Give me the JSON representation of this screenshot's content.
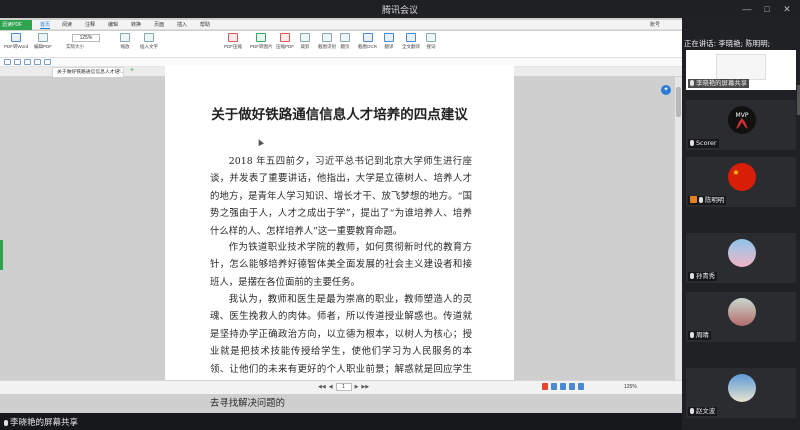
{
  "window": {
    "title": "腾讯会议",
    "buttons": [
      "—",
      "□",
      "✕"
    ]
  },
  "pdf_app": {
    "logo": "迅读PDF",
    "tabs": [
      "首页",
      "阅读",
      "注释",
      "编辑",
      "转换",
      "页面",
      "插入",
      "帮助"
    ],
    "active_tab": "首页",
    "account": "账号",
    "tools": [
      {
        "label": "PDF转Word",
        "icon": "word-icon"
      },
      {
        "label": "编辑PDF",
        "icon": "edit-icon"
      },
      {
        "label": "实际大小",
        "icon": "actual-size-icon"
      },
      {
        "label": "缩放",
        "icon": "zoom-icon"
      },
      {
        "label": "插入文字",
        "icon": "insert-text-icon"
      },
      {
        "label": "PDF压缩",
        "icon": "compress-icon"
      },
      {
        "label": "PDF转图片",
        "icon": "image-icon"
      },
      {
        "label": "压缩PDF",
        "icon": "compress-pdf-icon"
      },
      {
        "label": "裁剪",
        "icon": "crop-icon"
      },
      {
        "label": "截图识别",
        "icon": "screenshot-icon"
      },
      {
        "label": "翻页",
        "icon": "flip-icon"
      },
      {
        "label": "截图OCR",
        "icon": "ocr-icon"
      },
      {
        "label": "翻译",
        "icon": "translate-icon"
      },
      {
        "label": "全文翻译",
        "icon": "full-translate-icon"
      },
      {
        "label": "搜词",
        "icon": "search-word-icon"
      }
    ],
    "zoom_value": "125%",
    "doc_tab": "关于做好铁路通信信息人才培...",
    "page_current": "1",
    "zoom_status": "125%"
  },
  "document": {
    "title": "关于做好铁路通信信息人才培养的四点建议",
    "paragraphs": [
      "2018 年五四前夕，习近平总书记到北京大学师生进行座谈，并发表了重要讲话，他指出，大学是立德树人、培养人才的地方，是青年人学习知识、增长才干、放飞梦想的地方。“国势之强由于人，人才之成出于学”，提出了“为谁培养人、培养什么样的人、怎样培养人”这一重要教育命题。",
      "作为铁道职业技术学院的教师，如何贯彻新时代的教育方针，怎么能够培养好德智体美全面发展的社会主义建设者和接班人，是摆在各位面前的主要任务。",
      "我认为，教师和医生是最为崇高的职业，教师塑造人的灵魂、医生挽救人的肉体。师者，所以传道授业解惑也。传道就是坚持办学正确政治方向，以立德为根本，以树人为核心；授业就是把技术技能传授给学生，使他们学习为人民服务的本领、让他们的未来有更好的个人职业前景；解惑就是回应学生的疑问，不仅仅是简答的答案，更要启发创新，教会他们自己去寻找解决问题的"
    ]
  },
  "meeting": {
    "speaking_label": "正在讲话: 李晓艳; 陈明明;",
    "share_label": "李晓艳的屏幕共享",
    "participants": [
      {
        "name": "李晓艳的屏幕共享",
        "kind": "screen-share"
      },
      {
        "name": "Scorer",
        "avatar": "mvp-logo-avatar"
      },
      {
        "name": "陈明明",
        "avatar": "china-flag-avatar",
        "host": true
      },
      {
        "name": "孙青秀",
        "avatar": "balloons-avatar"
      },
      {
        "name": "周晴",
        "avatar": "photo-avatar"
      },
      {
        "name": "赵文波",
        "avatar": "sky-photo-avatar"
      }
    ]
  },
  "colors": {
    "accent_green": "#2ea44f",
    "accent_blue": "#1d7bd8",
    "panel_bg": "#202124"
  }
}
